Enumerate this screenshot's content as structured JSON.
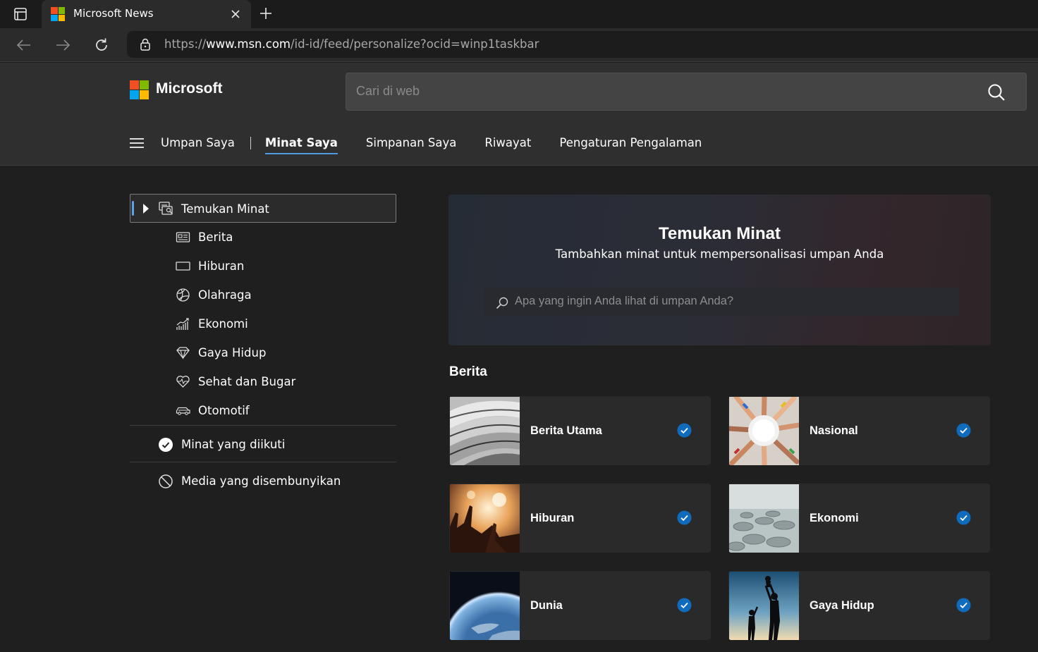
{
  "browser": {
    "tab_title": "Microsoft News",
    "url_scheme": "https://",
    "url_host": "www.msn.com",
    "url_path": "/id-id/feed/personalize?ocid=winp1taskbar"
  },
  "header": {
    "brand": "Microsoft",
    "search_placeholder": "Cari di web",
    "nav": {
      "feed": "Umpan Saya",
      "interests": "Minat Saya",
      "saved": "Simpanan Saya",
      "history": "Riwayat",
      "settings": "Pengaturan Pengalaman"
    }
  },
  "sidebar": {
    "discover": "Temukan Minat",
    "items": [
      {
        "label": "Berita",
        "icon": "newspaper-icon"
      },
      {
        "label": "Hiburan",
        "icon": "screen-icon"
      },
      {
        "label": "Olahraga",
        "icon": "ball-icon"
      },
      {
        "label": "Ekonomi",
        "icon": "chart-icon"
      },
      {
        "label": "Gaya Hidup",
        "icon": "diamond-icon"
      },
      {
        "label": "Sehat dan Bugar",
        "icon": "heart-pulse-icon"
      },
      {
        "label": "Otomotif",
        "icon": "car-icon"
      }
    ],
    "followed": "Minat yang diikuti",
    "hidden": "Media yang disembunyikan"
  },
  "hero": {
    "title": "Temukan Minat",
    "subtitle": "Tambahkan minat untuk mempersonalisasi umpan Anda",
    "search_placeholder": "Apa yang ingin Anda lihat di umpan Anda?"
  },
  "section": {
    "title": "Berita",
    "cards": [
      {
        "title": "Berita Utama",
        "followed": true
      },
      {
        "title": "Nasional",
        "followed": true
      },
      {
        "title": "Hiburan",
        "followed": true
      },
      {
        "title": "Ekonomi",
        "followed": true
      },
      {
        "title": "Dunia",
        "followed": true
      },
      {
        "title": "Gaya Hidup",
        "followed": true
      }
    ]
  },
  "colors": {
    "accent": "#4f9ae0",
    "check": "#0f6cbd",
    "ms_red": "#f25022",
    "ms_green": "#7fba00",
    "ms_blue": "#00a4ef",
    "ms_yellow": "#ffb900"
  }
}
